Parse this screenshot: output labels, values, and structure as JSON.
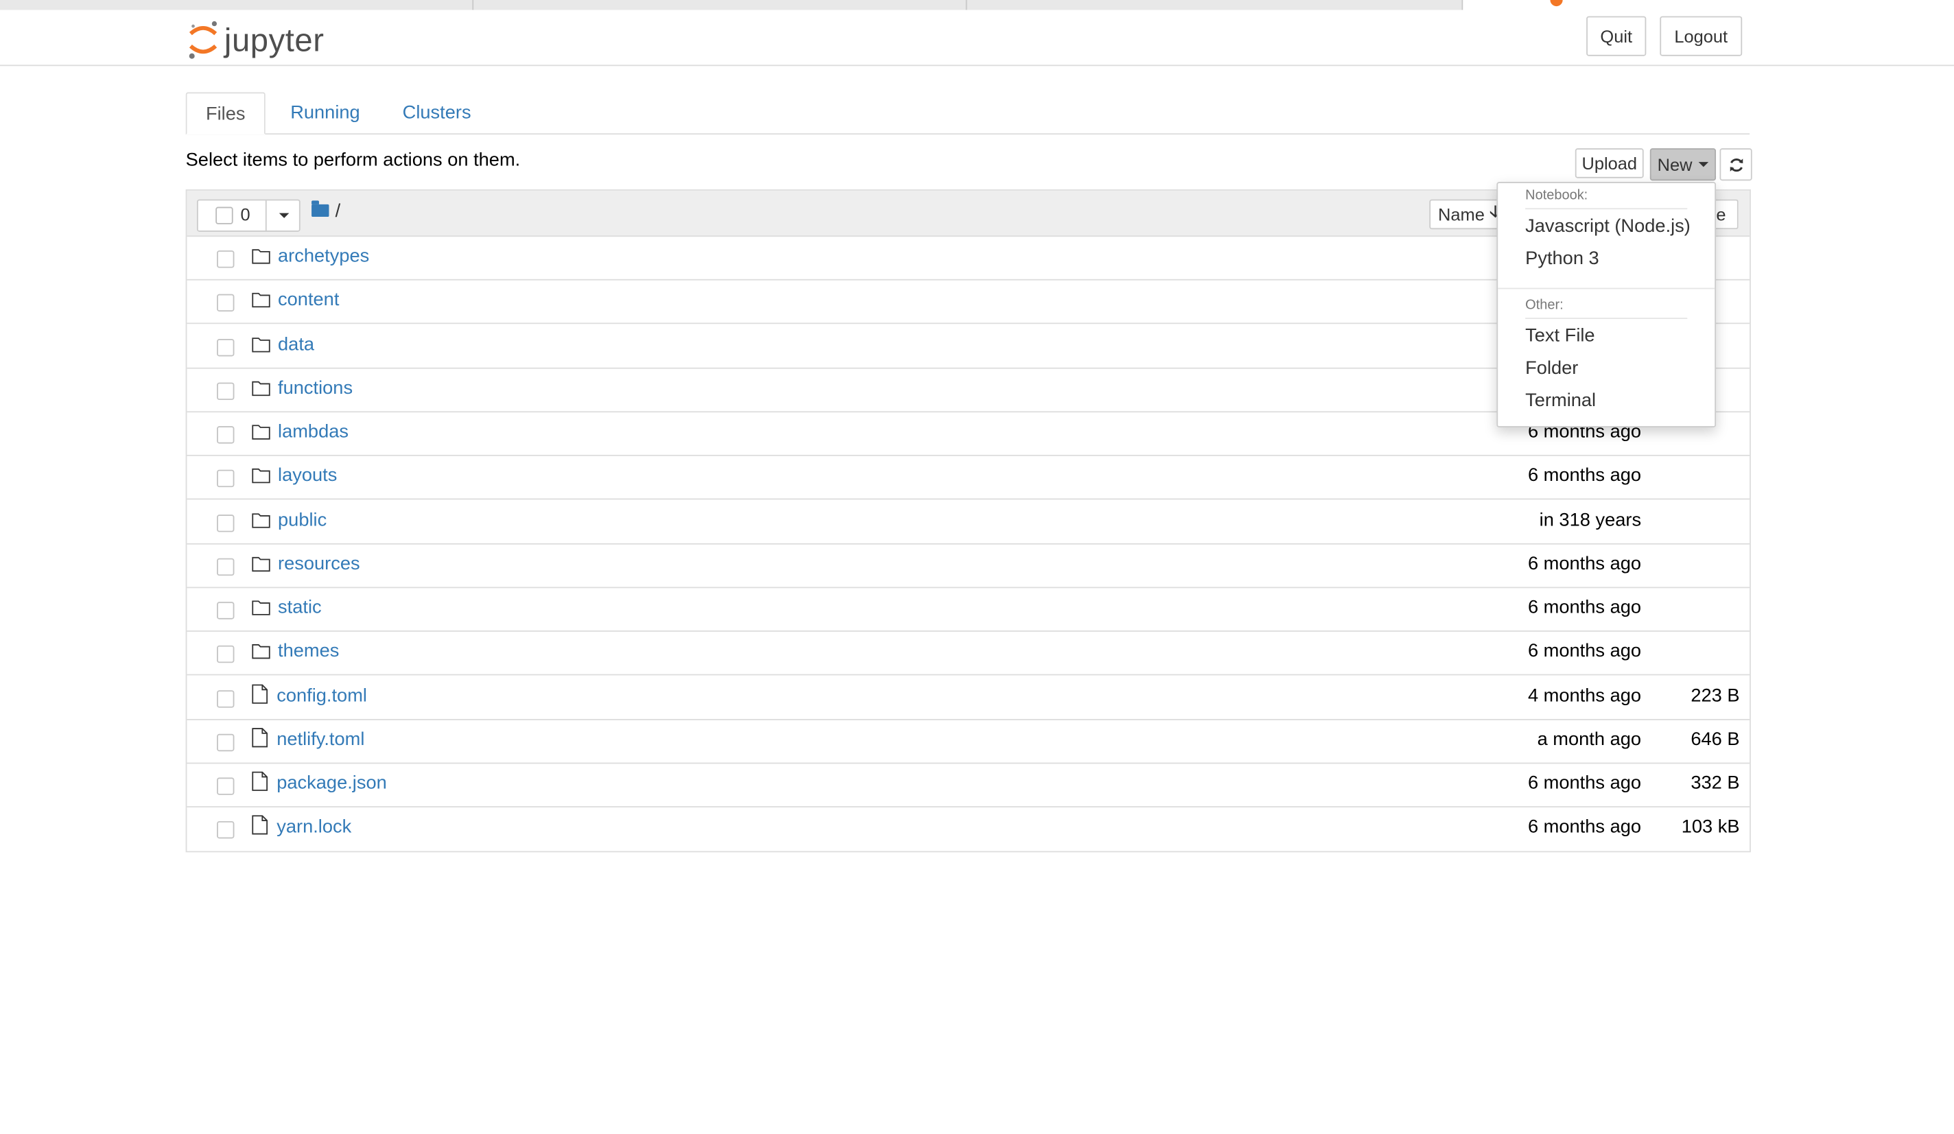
{
  "header": {
    "logo_text": "jupyter",
    "quit_label": "Quit",
    "logout_label": "Logout"
  },
  "tabs": [
    {
      "label": "Files",
      "active": true
    },
    {
      "label": "Running",
      "active": false
    },
    {
      "label": "Clusters",
      "active": false
    }
  ],
  "toolbar": {
    "hint": "Select items to perform actions on them.",
    "upload_label": "Upload",
    "new_label": "New"
  },
  "list_header": {
    "selected_count": "0",
    "breadcrumb": "/",
    "sort_name_label": "Name",
    "sort_size_label_visible": "ze"
  },
  "files": [
    {
      "name": "archetypes",
      "type": "folder",
      "modified": "",
      "size": ""
    },
    {
      "name": "content",
      "type": "folder",
      "modified": "",
      "size": ""
    },
    {
      "name": "data",
      "type": "folder",
      "modified": "",
      "size": ""
    },
    {
      "name": "functions",
      "type": "folder",
      "modified": "",
      "size": ""
    },
    {
      "name": "lambdas",
      "type": "folder",
      "modified": "6 months ago",
      "size": ""
    },
    {
      "name": "layouts",
      "type": "folder",
      "modified": "6 months ago",
      "size": ""
    },
    {
      "name": "public",
      "type": "folder",
      "modified": "in 318 years",
      "size": ""
    },
    {
      "name": "resources",
      "type": "folder",
      "modified": "6 months ago",
      "size": ""
    },
    {
      "name": "static",
      "type": "folder",
      "modified": "6 months ago",
      "size": ""
    },
    {
      "name": "themes",
      "type": "folder",
      "modified": "6 months ago",
      "size": ""
    },
    {
      "name": "config.toml",
      "type": "file",
      "modified": "4 months ago",
      "size": "223 B"
    },
    {
      "name": "netlify.toml",
      "type": "file",
      "modified": "a month ago",
      "size": "646 B"
    },
    {
      "name": "package.json",
      "type": "file",
      "modified": "6 months ago",
      "size": "332 B"
    },
    {
      "name": "yarn.lock",
      "type": "file",
      "modified": "6 months ago",
      "size": "103 kB"
    }
  ],
  "new_menu": {
    "notebook_header": "Notebook:",
    "notebook_items": [
      "Javascript (Node.js)",
      "Python 3"
    ],
    "other_header": "Other:",
    "other_items": [
      "Text File",
      "Folder",
      "Terminal"
    ]
  },
  "colors": {
    "link": "#337ab7",
    "logo_orange": "#f37726",
    "header_bg": "#eeeeee",
    "new_button_active": "#c8c8c8"
  },
  "icons": {
    "folder_row": "folder-outline-icon",
    "file_row": "file-outline-icon",
    "refresh": "refresh-icon",
    "breadcrumb": "folder-icon"
  }
}
